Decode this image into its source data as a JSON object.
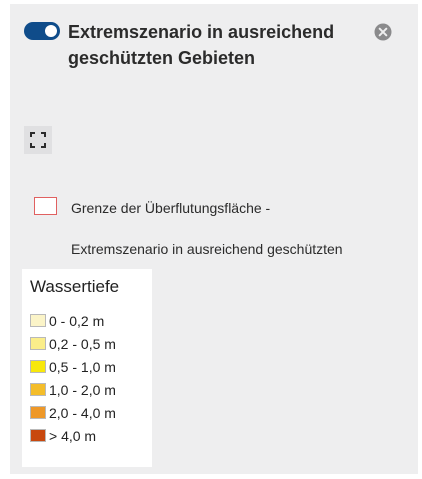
{
  "layer": {
    "title": "Extremszenario in ausreichend geschützten Gebieten",
    "visible": true,
    "toggle_color": "#0f4c8a"
  },
  "icons": {
    "close": "close-circle-icon",
    "expand": "fullscreen-expand-icon"
  },
  "boundary": {
    "label_line1": "Grenze der Überflutungsfläche -",
    "label_line2": "Extremszenario in ausreichend geschützten",
    "border_color": "#e06060"
  },
  "legend": {
    "title": "Wassertiefe",
    "items": [
      {
        "label": "0 - 0,2 m",
        "color": "#fbf4c8"
      },
      {
        "label": "0,2 - 0,5 m",
        "color": "#fbee8a"
      },
      {
        "label": "0,5 - 1,0 m",
        "color": "#f8e80c"
      },
      {
        "label": "1,0 - 2,0 m",
        "color": "#f4bd2a"
      },
      {
        "label": "2,0 - 4,0 m",
        "color": "#ee9828"
      },
      {
        "label": "> 4,0 m",
        "color": "#c8480e"
      }
    ]
  }
}
